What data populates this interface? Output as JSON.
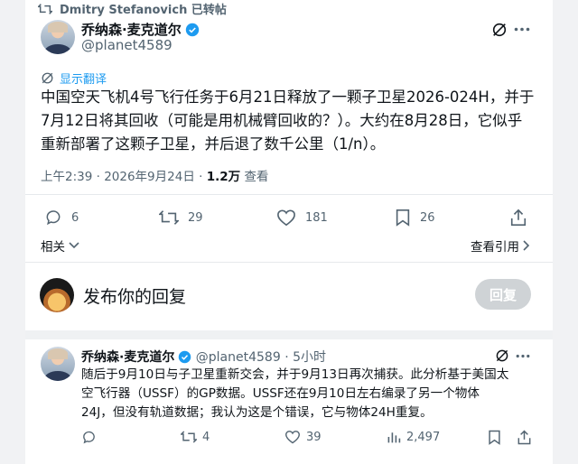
{
  "retweet": {
    "text": "Dmitry Stefanovich 已转帖"
  },
  "post": {
    "author_name": "乔纳森·麦克道尔",
    "author_handle": "@planet4589",
    "translate_label": "显示翻译",
    "body_line1": "中国空天飞机4号飞行任务于6月21日释放了一颗子卫星2026-024H，并于",
    "body_line2": "7月12日将其回收（可能是用机械臂回收的？）。大约在8月28日，它似乎",
    "body_line3": "重新部署了这颗子卫星，并后退了数千公里（1/n）。",
    "timestamp": "上午2:39 · 2026年9月24日",
    "views_count": "1.2万",
    "views_label": "查看",
    "replies": "6",
    "reposts": "29",
    "likes": "181",
    "bookmarks": "26",
    "related_label": "相关",
    "quotes_label": "查看引用"
  },
  "compose": {
    "placeholder": "发布你的回复",
    "reply_button": "回复"
  },
  "reply_post": {
    "author_name": "乔纳森·麦克道尔",
    "author_handle": "@planet4589",
    "time": "· 5小时",
    "body_line1": "随后于9月10日与子卫星重新交会，并于9月13日再次捕获。此分析基于美国太",
    "body_line2": "空飞行器（USSF）的GP数据。USSF还在9月10日左右编录了另一个物体",
    "body_line3": "24J，但没有轨道数据；我认为这是个错误，它与物体24H重复。",
    "replies": "",
    "reposts": "4",
    "likes": "39",
    "views": "2,497"
  },
  "colors": {
    "accent": "#1d9bf0",
    "muted": "#536471",
    "divider": "#e6e9ec",
    "reply_button": "#cfd3d6"
  },
  "icons": [
    "retweet-icon",
    "verified-icon",
    "grok-icon",
    "more-icon",
    "translate-icon",
    "reply-icon",
    "repost-icon",
    "like-icon",
    "bookmark-icon",
    "share-icon",
    "chevron-down-icon",
    "chevron-right-icon",
    "views-icon"
  ]
}
